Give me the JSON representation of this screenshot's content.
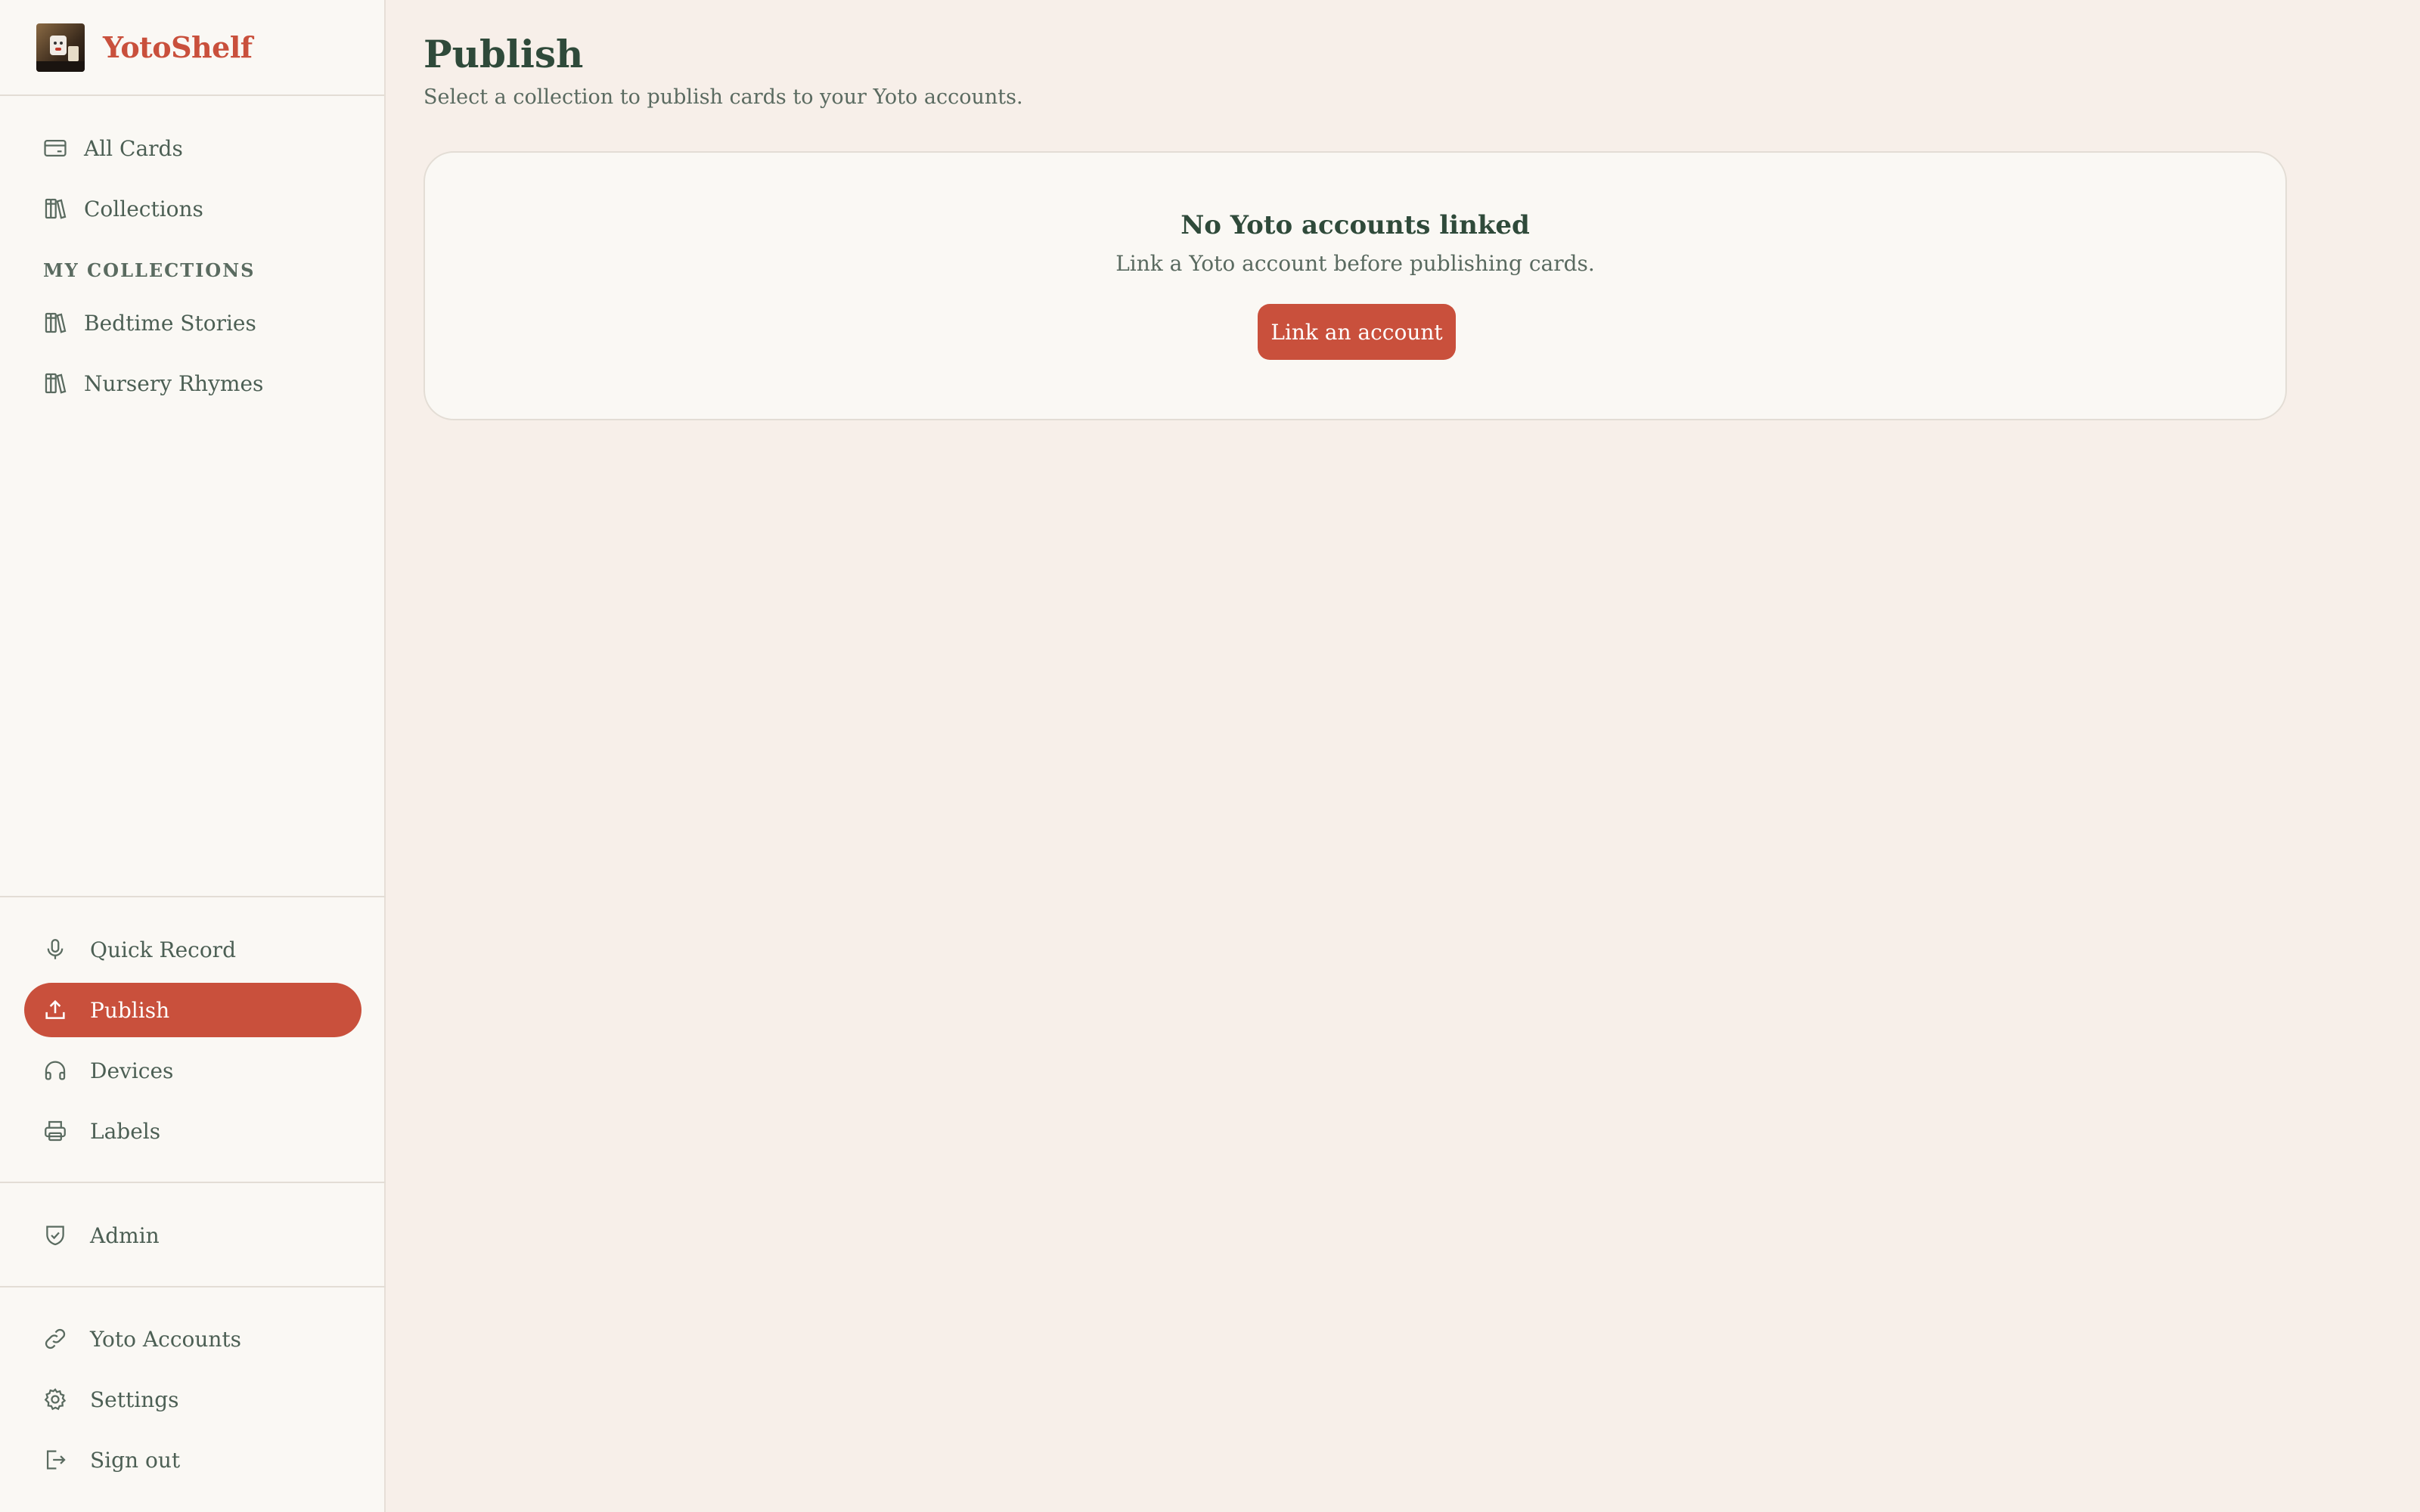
{
  "app": {
    "name": "YotoShelf",
    "logo_icon": "app-logo-avatar"
  },
  "sidebar": {
    "top_items": [
      {
        "label": "All Cards",
        "icon": "card-icon"
      },
      {
        "label": "Collections",
        "icon": "books-icon"
      }
    ],
    "my_collections_heading": "MY COLLECTIONS",
    "collections": [
      {
        "label": "Bedtime Stories",
        "icon": "books-icon"
      },
      {
        "label": "Nursery Rhymes",
        "icon": "books-icon"
      }
    ],
    "tools": [
      {
        "label": "Quick Record",
        "icon": "microphone-icon"
      },
      {
        "label": "Publish",
        "icon": "upload-icon",
        "active": true
      },
      {
        "label": "Devices",
        "icon": "headphones-icon"
      },
      {
        "label": "Labels",
        "icon": "printer-icon"
      }
    ],
    "admin": [
      {
        "label": "Admin",
        "icon": "shield-check-icon"
      }
    ],
    "account": [
      {
        "label": "Yoto Accounts",
        "icon": "link-icon"
      },
      {
        "label": "Settings",
        "icon": "gear-icon"
      },
      {
        "label": "Sign out",
        "icon": "sign-out-icon"
      }
    ]
  },
  "main": {
    "title": "Publish",
    "subtitle": "Select a collection to publish cards to your Yoto accounts.",
    "empty_state": {
      "title": "No Yoto accounts linked",
      "text": "Link a Yoto account before publishing cards.",
      "button_label": "Link an account"
    }
  },
  "colors": {
    "accent": "#c9503c",
    "heading": "#2f4a3a",
    "background": "#f7efe9",
    "panel": "#faf8f4"
  }
}
